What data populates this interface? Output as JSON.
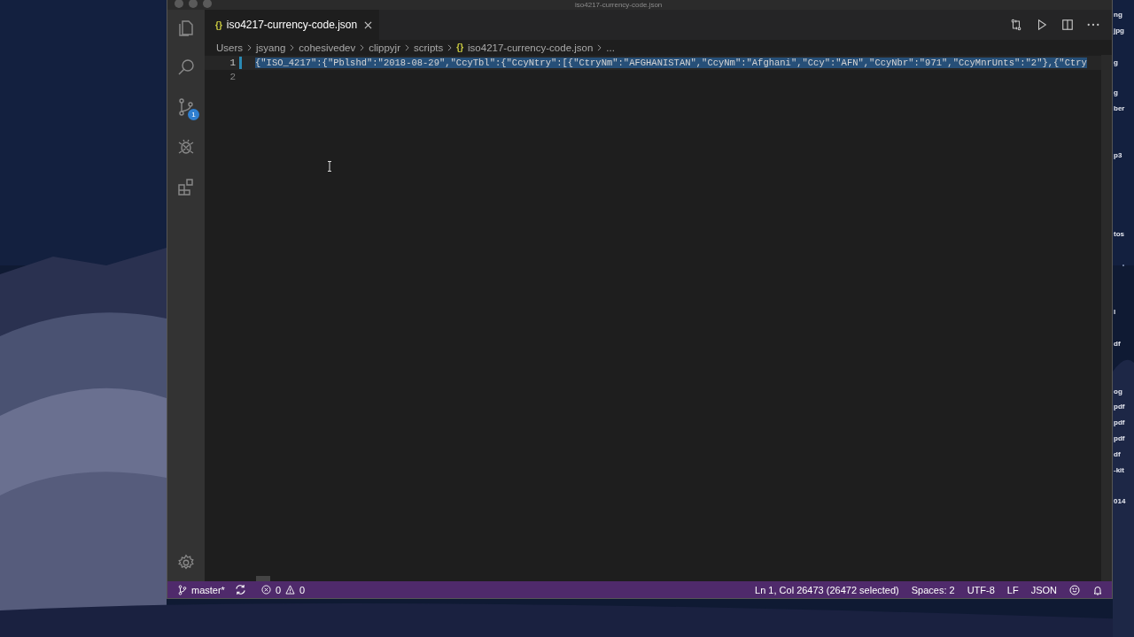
{
  "window": {
    "title": "iso4217-currency-code.json"
  },
  "desktop": {
    "kind": "picture",
    "labels": [
      "ng",
      "jpg",
      "g",
      "g",
      "ber",
      "p3",
      "tos",
      "l",
      "df",
      "og",
      "pdf",
      "pdf",
      "pdf",
      "df",
      "-kit",
      "014"
    ]
  },
  "activity_bar": {
    "items": [
      {
        "kind": "files",
        "selected": false
      },
      {
        "kind": "search",
        "selected": false
      },
      {
        "kind": "source-control",
        "selected": false,
        "badge": "1"
      },
      {
        "kind": "debug",
        "selected": false
      },
      {
        "kind": "extensions",
        "selected": false
      }
    ]
  },
  "tabs": [
    {
      "label": "iso4217-currency-code.json",
      "icon": "{}",
      "selected": true
    }
  ],
  "breadcrumbs": [
    {
      "label": "Users"
    },
    {
      "label": "jsyang"
    },
    {
      "label": "cohesivedev"
    },
    {
      "label": "clippyjr"
    },
    {
      "label": "scripts"
    },
    {
      "label": "iso4217-currency-code.json",
      "icon": "{}"
    },
    {
      "label": "..."
    }
  ],
  "editor": {
    "lines": [
      {
        "number": "1",
        "text": "{\"ISO_4217\":{\"Pblshd\":\"2018-08-29\",\"CcyTbl\":{\"CcyNtry\":[{\"CtryNm\":\"AFGHANISTAN\",\"CcyNm\":\"Afghani\",\"Ccy\":\"AFN\",\"CcyNbr\":\"971\",\"CcyMnrUnts\":\"2\"},{\"Ctry",
        "selected": true
      },
      {
        "number": "2",
        "selected": false
      }
    ]
  },
  "status_bar": {
    "branch": "master*",
    "errors": "0",
    "warnings": "0",
    "items": [
      "Ln 1, Col 26473 (26472 selected)",
      "Spaces: 2",
      "UTF-8",
      "LF",
      "JSON"
    ]
  }
}
